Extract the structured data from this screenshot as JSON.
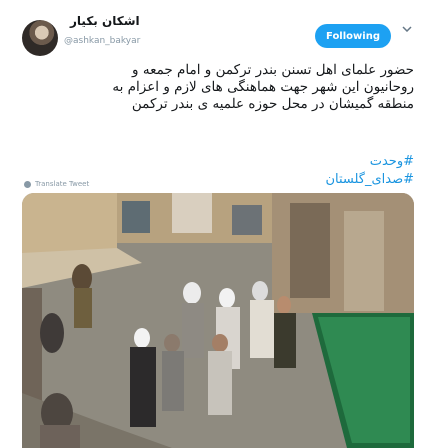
{
  "tweet": {
    "display_name": "اشکان بکیار",
    "handle": "@ashkan_bakyar",
    "follow_label": "Following",
    "text_lines": [
      "حضور علمای اهل تسنن بندر ترکمن و امام جمعه و",
      "روحانیون این شهر جهت هماهنگی های لازم و اعزام به",
      "منطقه گمیشان در محل حوزه علمیه ی بندر ترکمن"
    ],
    "hashtags": [
      "#وحدت",
      "#صدای_گلستان"
    ],
    "translate_label": "Translate Tweet"
  },
  "icons": {
    "more": "chevron-down-icon",
    "translate": "globe-icon"
  },
  "colors": {
    "accent": "#1da1f2",
    "link": "#1b95e0",
    "muted": "#8899a6"
  }
}
